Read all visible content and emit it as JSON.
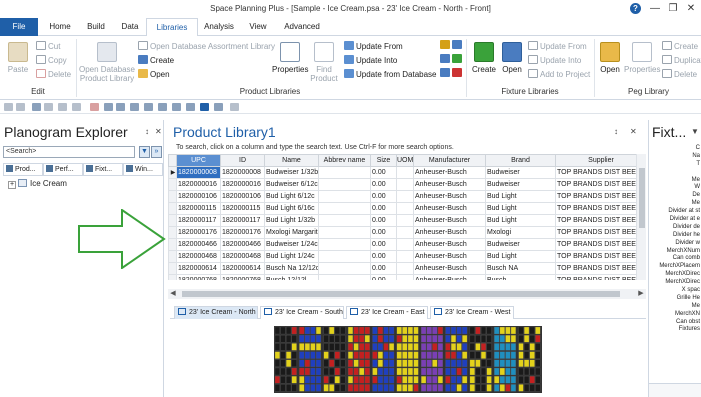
{
  "window": {
    "title": "Space Planning Plus - [Sample - Ice Cream.psa - 23' Ice Cream - North - Front]",
    "help": "?",
    "minimize": "—",
    "restore": "❐",
    "close": "✕"
  },
  "menu": {
    "file": "File",
    "tabs": [
      "Home",
      "Build",
      "Data",
      "Libraries",
      "Analysis",
      "View",
      "Advanced"
    ],
    "active": "Libraries"
  },
  "ribbon": {
    "edit": {
      "label": "Edit",
      "paste": "Paste",
      "cut": "Cut",
      "copy": "Copy",
      "delete": "Delete"
    },
    "product_libraries": {
      "label": "Product Libraries",
      "open_db": "Open Database",
      "product_library": "Product Library",
      "open_db_assortment": "Open Database Assortment Library",
      "create": "Create",
      "open": "Open",
      "properties": "Properties",
      "find": "Find",
      "product": "Product",
      "update_from": "Update From",
      "update_into": "Update Into",
      "update_from_db": "Update from Database"
    },
    "fixture_libraries": {
      "label": "Fixture Libraries",
      "create": "Create",
      "open": "Open",
      "update_from": "Update From",
      "update_into": "Update Into",
      "add_to_project": "Add to Project"
    },
    "peg_library": {
      "label": "Peg Library",
      "open": "Open",
      "properties": "Properties",
      "create": "Create",
      "duplicate": "Duplicate",
      "delete": "Delete"
    }
  },
  "left_pane": {
    "title": "Planogram Explorer",
    "pin": "↕",
    "close": "✕",
    "search_value": "<Search>",
    "dropdown": "▼",
    "go": "»",
    "tabs": [
      "Prod...",
      "Perf...",
      "Fixt...",
      "Win..."
    ],
    "tree_expand": "+",
    "tree_root": "Ice Cream"
  },
  "product_library": {
    "title": "Product Library1",
    "pin": "↕",
    "close": "✕",
    "hint": "To search, click on a column and type the search text.  Use Ctrl-F for more search options.",
    "columns": [
      "UPC",
      "ID",
      "Name",
      "Abbrev name",
      "Size",
      "UOM",
      "Manufacturer",
      "Brand",
      "Supplier"
    ],
    "rows": [
      [
        "1820000008",
        "1820000008",
        "Budweiser 1/32b",
        "",
        "0.00",
        "",
        "Anheuser-Busch",
        "Budweiser",
        "TOP BRANDS DIST BEER"
      ],
      [
        "1820000016",
        "1820000016",
        "Budweiser 6/12c",
        "",
        "0.00",
        "",
        "Anheuser-Busch",
        "Budweiser",
        "TOP BRANDS DIST BEER"
      ],
      [
        "1820000106",
        "1820000106",
        "Bud Light 6/12c",
        "",
        "0.00",
        "",
        "Anheuser-Busch",
        "Bud Light",
        "TOP BRANDS DIST BEER"
      ],
      [
        "1820000115",
        "1820000115",
        "Bud Light 6/16c",
        "",
        "0.00",
        "",
        "Anheuser-Busch",
        "Bud Light",
        "TOP BRANDS DIST BEER"
      ],
      [
        "1820000117",
        "1820000117",
        "Bud Light 1/32b",
        "",
        "0.00",
        "",
        "Anheuser-Busch",
        "Bud Light",
        "TOP BRANDS DIST BEER"
      ],
      [
        "1820000176",
        "1820000176",
        "Mxologi Margarita 1/",
        "",
        "0.00",
        "",
        "Anheuser-Busch",
        "Mxologi",
        "TOP BRANDS DIST BEER"
      ],
      [
        "1820000466",
        "1820000466",
        "Budweiser 1/24c",
        "",
        "0.00",
        "",
        "Anheuser-Busch",
        "Budweiser",
        "TOP BRANDS DIST BEER"
      ],
      [
        "1820000468",
        "1820000468",
        "Bud Light 1/24c",
        "",
        "0.00",
        "",
        "Anheuser-Busch",
        "Bud Light",
        "TOP BRANDS DIST BEER"
      ],
      [
        "1820000614",
        "1820000614",
        "Busch Na 12/12c",
        "",
        "0.00",
        "",
        "Anheuser-Busch",
        "Busch NA",
        "TOP BRANDS DIST BEER"
      ],
      [
        "1820000768",
        "1820000768",
        "Busch 12/12l",
        "",
        "0.00",
        "",
        "Anheuser-Busch",
        "Busch",
        "TOP BRANDS DIST BEER"
      ]
    ],
    "row_indicator": "▶",
    "scroll_left": "◀",
    "scroll_right": "▶",
    "doc_tabs": [
      "23' Ice Cream - North",
      "23' Ice Cream - South",
      "23' Ice Cream - East",
      "23' Ice Cream - West"
    ],
    "active_doc_tab": 0
  },
  "right_pane": {
    "title": "Fixt...",
    "dropdown": "▼",
    "labels": [
      "C",
      "Na",
      "T",
      "",
      "Me",
      "W",
      "De",
      "Me",
      "Divider at st",
      "Divider at e",
      "Divider de",
      "Divider he",
      "Divider w",
      "MerchXNum",
      "Can comb",
      "MerchXPlacem",
      "MerchXDirec",
      "MerchXDirec",
      "X spac",
      "Grille He",
      "Me",
      "MerchXN",
      "Can obst",
      "Fixtures"
    ]
  },
  "colors": {
    "accent": "#1f5fa8",
    "selected_cell": "#2f6ec0",
    "arrow": "#3aa23a"
  }
}
